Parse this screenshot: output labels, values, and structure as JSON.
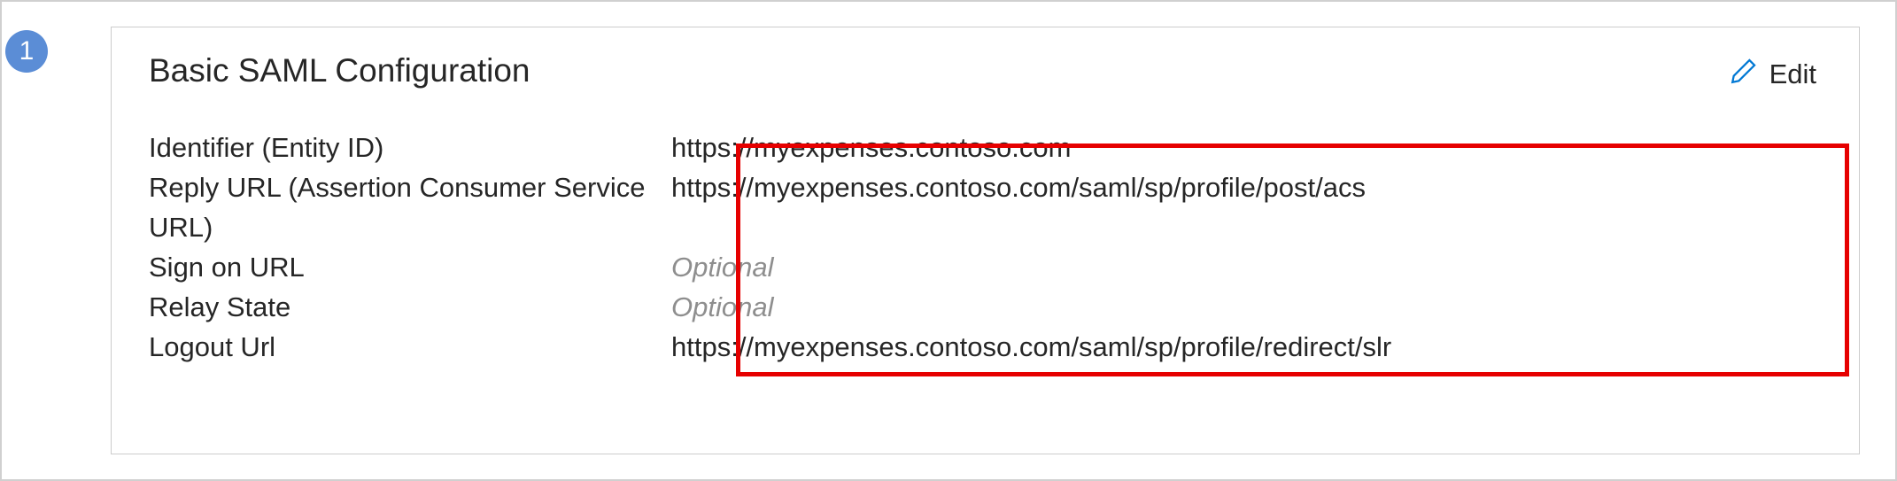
{
  "step": {
    "number": "1"
  },
  "card": {
    "title": "Basic SAML Configuration",
    "edit_label": "Edit"
  },
  "config": {
    "rows": [
      {
        "label": "Identifier (Entity ID)",
        "value": "https://myexpenses.contoso.com",
        "optional": false
      },
      {
        "label": "Reply URL (Assertion Consumer Service URL)",
        "value": "https://myexpenses.contoso.com/saml/sp/profile/post/acs",
        "optional": false
      },
      {
        "label": "Sign on URL",
        "value": "Optional",
        "optional": true
      },
      {
        "label": "Relay State",
        "value": "Optional",
        "optional": true
      },
      {
        "label": "Logout Url",
        "value": "https://myexpenses.contoso.com/saml/sp/profile/redirect/slr",
        "optional": false
      }
    ]
  }
}
